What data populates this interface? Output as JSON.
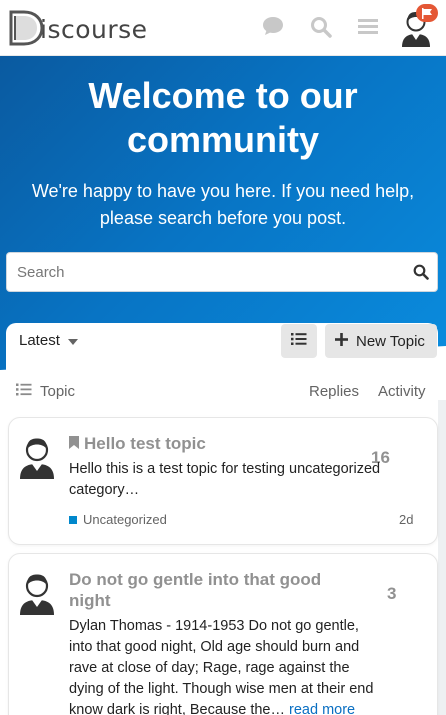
{
  "header": {
    "logo_text": "iscourse",
    "logo_letter": "D",
    "icons": [
      "chat-icon",
      "search-icon",
      "hamburger-menu-icon",
      "user-avatar-icon",
      "notification-badge-icon"
    ]
  },
  "hero": {
    "title": "Welcome to our community",
    "subtitle": "We're happy to have you here. If you need help, please search before you post.",
    "search_placeholder": "Search"
  },
  "topic_list": {
    "filter_label": "Latest",
    "new_topic_label": "New Topic",
    "columns": {
      "topic": "Topic",
      "replies": "Replies",
      "activity": "Activity"
    },
    "topics": [
      {
        "title": "Hello test topic",
        "excerpt": "Hello this is a test topic for testing uncategorized category…",
        "replies": "16",
        "category": "Uncategorized",
        "activity": "2d",
        "bookmarked": true
      },
      {
        "title": "Do not go gentle into that good night",
        "excerpt": "Dylan Thomas - 1914-1953 Do not go gentle, into that good night, Old age should burn and rave at close of day; Rage, rage against the dying of the light. Though wise men at their end know dark is right, Because the…",
        "read_more": "read more",
        "replies": "3"
      }
    ]
  },
  "colors": {
    "brand_blue": "#0874c4",
    "category_blue": "#0088cc",
    "notification_red": "#e45735",
    "link_blue": "#0a6fc2"
  }
}
